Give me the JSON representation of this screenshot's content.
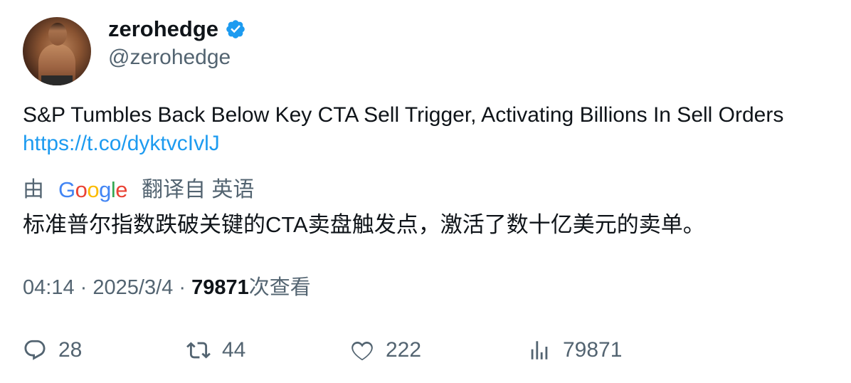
{
  "author": {
    "display_name": "zerohedge",
    "handle": "@zerohedge",
    "verified": true
  },
  "tweet": {
    "text": "S&P Tumbles Back Below Key CTA Sell Trigger, Activating Billions In Sell Orders",
    "link": "https://t.co/dyktvcIvlJ"
  },
  "translation": {
    "prefix": "由",
    "provider": "Google",
    "suffix": "翻译自 英语",
    "text": "标准普尔指数跌破关键的CTA卖盘触发点，激活了数十亿美元的卖单。"
  },
  "meta": {
    "time": "04:14",
    "separator": "·",
    "date": "2025/3/4",
    "views": "79871",
    "views_label": "次查看"
  },
  "actions": {
    "replies": "28",
    "retweets": "44",
    "likes": "222",
    "views": "79871"
  },
  "colors": {
    "verified": "#1d9bf0",
    "link": "#1d9bf0",
    "secondary_text": "#536471"
  }
}
